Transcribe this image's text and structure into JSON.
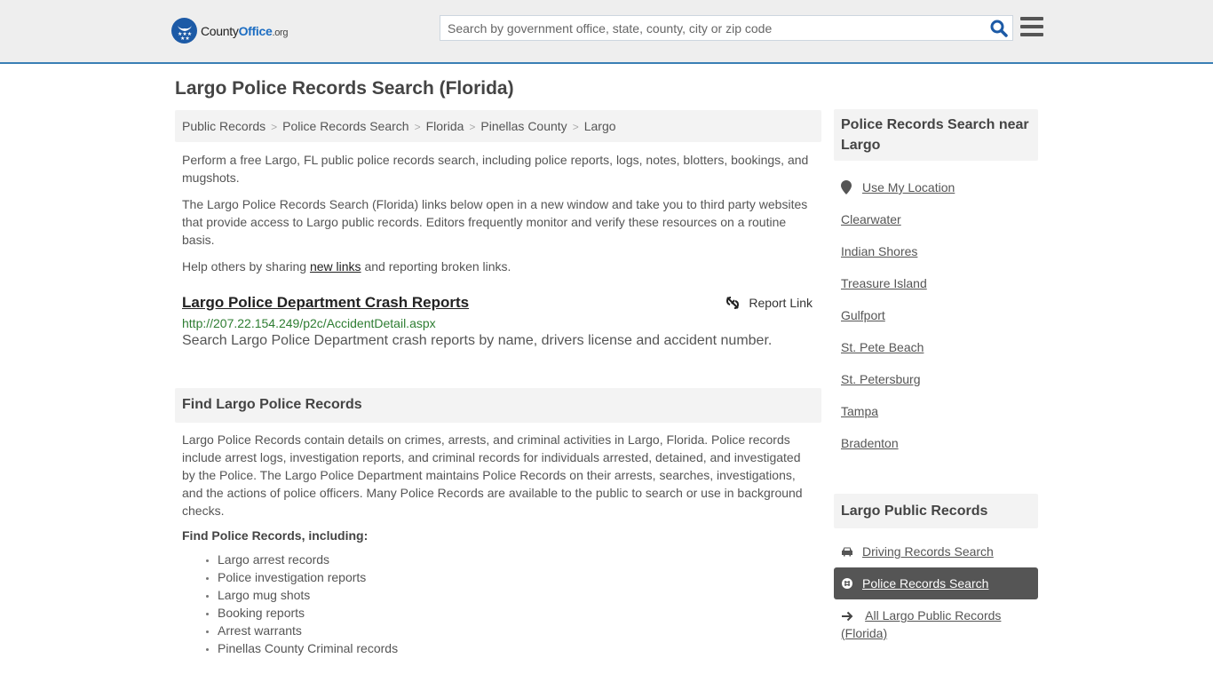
{
  "header": {
    "logo": {
      "county": "County",
      "office": "Office",
      "org": ".org"
    },
    "search_placeholder": "Search by government office, state, county, city or zip code",
    "search_value": "",
    "colors": {
      "accent": "#3a7fb5",
      "logo_blue": "#1c5aa6",
      "link_green": "#2e7d32"
    }
  },
  "page": {
    "title": "Largo Police Records Search (Florida)"
  },
  "breadcrumb": [
    {
      "label": "Public Records"
    },
    {
      "label": "Police Records Search"
    },
    {
      "label": "Florida"
    },
    {
      "label": "Pinellas County"
    },
    {
      "label": "Largo"
    }
  ],
  "breadcrumb_sep": ">",
  "intro": {
    "p1": "Perform a free Largo, FL public police records search, including police reports, logs, notes, blotters, bookings, and mugshots.",
    "p2": "The Largo Police Records Search (Florida) links below open in a new window and take you to third party websites that provide access to Largo public records. Editors frequently monitor and verify these resources on a routine basis.",
    "p3_before": "Help others by sharing ",
    "p3_link": "new links",
    "p3_after": " and reporting broken links."
  },
  "links": [
    {
      "title": "Largo Police Department Crash Reports",
      "url": "http://207.22.154.249/p2c/AccidentDetail.aspx",
      "description": "Search Largo Police Department crash reports by name, drivers license and accident number.",
      "report_label": "Report Link"
    }
  ],
  "find_section": {
    "heading": "Find Largo Police Records",
    "body": "Largo Police Records contain details on crimes, arrests, and criminal activities in Largo, Florida. Police records include arrest logs, investigation reports, and criminal records for individuals arrested, detained, and investigated by the Police. The Largo Police Department maintains Police Records on their arrests, searches, investigations, and the actions of police officers. Many Police Records are available to the public to search or use in background checks.",
    "subheading": "Find Police Records, including:",
    "items": [
      "Largo arrest records",
      "Police investigation reports",
      "Largo mug shots",
      "Booking reports",
      "Arrest warrants",
      "Pinellas County Criminal records"
    ]
  },
  "sidebar": {
    "nearby_heading": "Police Records Search near Largo",
    "use_location": "Use My Location",
    "nearby": [
      "Clearwater",
      "Indian Shores",
      "Treasure Island",
      "Gulfport",
      "St. Pete Beach",
      "St. Petersburg",
      "Tampa",
      "Bradenton"
    ],
    "public_heading": "Largo Public Records",
    "public_links": [
      {
        "label": "Driving Records Search",
        "icon": "car-icon",
        "active": false
      },
      {
        "label": "Police Records Search",
        "icon": "police-badge-icon",
        "active": true
      },
      {
        "label": "All Largo Public Records (Florida)",
        "icon": "arrow-right-icon",
        "active": false
      }
    ]
  }
}
